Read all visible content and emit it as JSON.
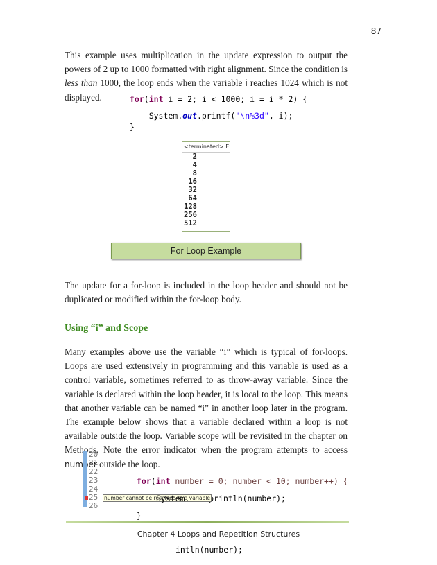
{
  "page_number": "87",
  "para1": {
    "a": "This example uses multiplication in the update expression to output the powers of 2 up to 1000 formatted with right alignment.  Since the condition is ",
    "em": "less than",
    "b": " 1000, the loop ends when the variable ",
    "var": "i",
    "c": " reaches 1024 which is not displayed."
  },
  "code1": {
    "l1_kw1": "for",
    "l1_a": "(",
    "l1_kw2": "int",
    "l1_b": " i = 2; i < 1000; i = i * 2) {",
    "l2_a": "    System.",
    "l2_fld": "out",
    "l2_b": ".printf(",
    "l2_str": "\"\\n%3d\"",
    "l2_c": ", i);",
    "l3": "}"
  },
  "console": {
    "header": "<terminated> Ex_",
    "values": [
      "2",
      "4",
      "8",
      "16",
      "32",
      "64",
      "128",
      "256",
      "512"
    ]
  },
  "caption": "For Loop Example",
  "para2": "The update for a for-loop is included in the loop header and should not be duplicated or modified within the for-loop body.",
  "heading": "Using “i” and Scope",
  "para3": {
    "a": "Many examples above use the variable “i” which is typical of for-loops.  Loops are used extensively in programming and this variable is used as a control variable, sometimes referred to as throw-away variable.  Since the variable is declared within the loop header, it is local to the loop.  This means that another variable can be named “i” in another loop later in the program.  The example below shows that a variable declared within a loop is not available outside the loop.  Variable scope will be revisited in the chapter on Methods.   Note the error indicator when the program attempts to access ",
    "var": "number",
    "b": " outside the loop."
  },
  "ide": {
    "line_numbers": [
      "20",
      "21",
      "22",
      "23",
      "24",
      "25",
      "26"
    ],
    "l21_kw1": "for",
    "l21_a": "(",
    "l21_kw2": "int",
    "l21_b": " number = 0; number < 10; number++) {",
    "l22_a": "    System.",
    "l22_fld": "out",
    "l22_b": ".println(number);",
    "l23": "}",
    "l25": "intln(number);",
    "tooltip": "number cannot be resolved to a variable"
  },
  "footer": "Chapter 4 Loops and Repetition Structures"
}
